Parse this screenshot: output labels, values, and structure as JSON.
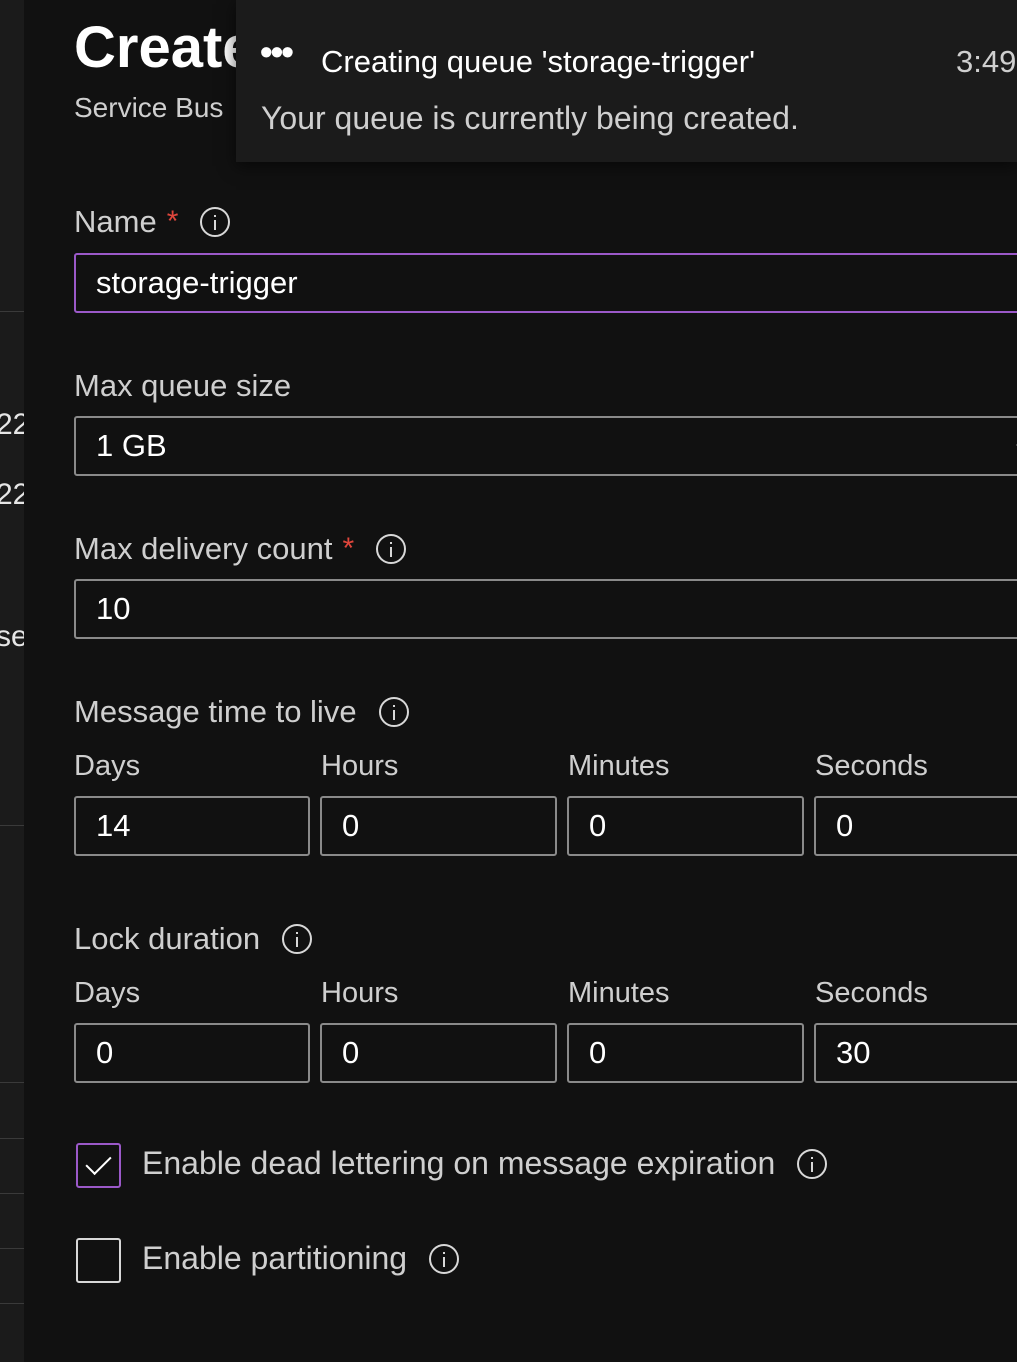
{
  "background_fragments": [
    "22",
    "22",
    "se"
  ],
  "header": {
    "title": "Create",
    "subtitle": "Service Bus"
  },
  "notification": {
    "icon": "more-dots-icon",
    "title": "Creating queue 'storage-trigger'",
    "time": "3:49",
    "message": "Your queue is currently being created."
  },
  "form": {
    "name": {
      "label": "Name",
      "required_mark": "*",
      "value": "storage-trigger"
    },
    "max_queue_size": {
      "label": "Max queue size",
      "value": "1 GB"
    },
    "max_delivery_count": {
      "label": "Max delivery count",
      "required_mark": "*",
      "value": "10"
    },
    "message_ttl": {
      "label": "Message time to live",
      "days_label": "Days",
      "hours_label": "Hours",
      "minutes_label": "Minutes",
      "seconds_label": "Seconds",
      "days": "14",
      "hours": "0",
      "minutes": "0",
      "seconds": "0"
    },
    "lock_duration": {
      "label": "Lock duration",
      "days_label": "Days",
      "hours_label": "Hours",
      "minutes_label": "Minutes",
      "seconds_label": "Seconds",
      "days": "0",
      "hours": "0",
      "minutes": "0",
      "seconds": "30"
    },
    "dead_lettering": {
      "label": "Enable dead lettering on message expiration",
      "checked": true
    },
    "partitioning": {
      "label": "Enable partitioning",
      "checked": false
    }
  },
  "colors": {
    "accent": "#9b59c9",
    "required": "#e0463c",
    "background": "#111111"
  }
}
